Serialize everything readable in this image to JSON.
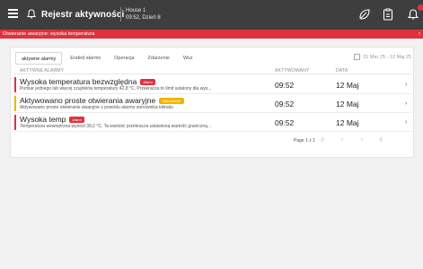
{
  "header": {
    "title": "Rejestr aktywności",
    "house_line1": "House 1",
    "house_line2": "09:52, Dzień 8"
  },
  "banner": {
    "text": "Otwieranie awaryjne: wysoka temperatura"
  },
  "tabs": [
    "aktywne alarmy",
    "Ended alarms",
    "Operacja",
    "Zdarzenie",
    "Wsz"
  ],
  "date_range": "31 Mar 25 - 12 Maj 25",
  "columns": {
    "name": "AKTYWNE ALARMY",
    "activated": "AKTYWOWANY",
    "date": "DATA"
  },
  "rows": [
    {
      "name": "Wysoka temperatura bezwzględna",
      "badge": "Alarm",
      "description": "Pomiar jednego lub więcej czujników temperatury 42,8 °C. Przekracza to limit ustalony dla wys...",
      "time": "09:52",
      "date": "12 Maj"
    },
    {
      "name": "Aktywowano proste otwierania awaryjne",
      "badge": "Ostrzeżenie",
      "description": "Aktywowano proste otwieranie awaryjne z powodu alarmu sterownika klimatu",
      "time": "09:52",
      "date": "12 Maj"
    },
    {
      "name": "Wysoka temp",
      "badge": "Alarm",
      "description": "Temperatura wewnętrzna wynosi 39,2 °C. Ta wartość przekracza ustawioną wartość graniczną...",
      "time": "09:52",
      "date": "12 Maj"
    }
  ],
  "pager": {
    "text": "Page 1 z 1"
  },
  "colors": {
    "alarm": "#e0323c",
    "warning": "#f0b400",
    "topbar": "#3e3e3e"
  },
  "icons": [
    "menu-icon",
    "bell-icon",
    "leaf-icon",
    "clipboard-icon",
    "notification-bell-icon",
    "calendar-icon",
    "chevron-right-icon"
  ]
}
